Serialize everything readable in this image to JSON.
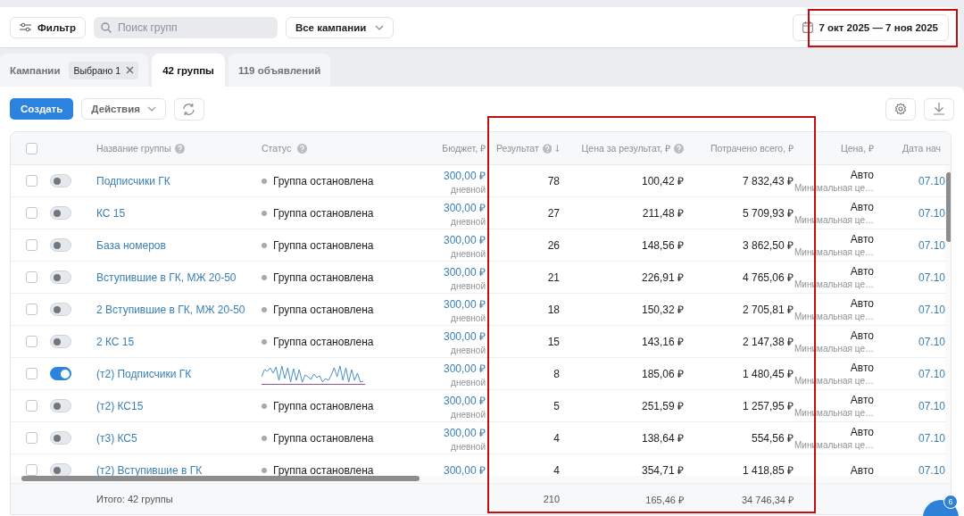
{
  "toolbar": {
    "filter_label": "Фильтр",
    "search": {
      "placeholder": "Поиск групп"
    },
    "campaign_select": "Все кампании",
    "date_range": "7 окт 2025 — 7 ноя 2025"
  },
  "tabs": [
    {
      "label": "Кампании",
      "chip": "Выбрано 1",
      "selected": false
    },
    {
      "label": "42 группы",
      "selected": true
    },
    {
      "label": "119 объявлений",
      "selected": false
    }
  ],
  "actions": {
    "create": "Создать",
    "actions_menu": "Действия"
  },
  "table": {
    "select_all": {
      "checked": false
    },
    "columns": [
      {
        "label": "Название группы",
        "help": true
      },
      {
        "label": "Статус",
        "help": true
      },
      {
        "label": "Бюджет, ₽",
        "help": false
      },
      {
        "label": "Результат",
        "help": true,
        "sorted": true
      },
      {
        "label": "Цена за результат, ₽",
        "help": true
      },
      {
        "label": "Потрачено всего, ₽",
        "help": false
      },
      {
        "label": "Цена, ₽",
        "help": false
      },
      {
        "label": "Дата нач",
        "help": false
      }
    ],
    "rows": [
      {
        "checked": false,
        "on": false,
        "name": "Подписчики ГК",
        "status": {
          "kind": "stopped",
          "text": "Группа остановлена"
        },
        "budget": "300,00 ₽",
        "budget_note": "дневной",
        "result": "78",
        "cost_per_result": "100,42 ₽",
        "spent": "7 832,43 ₽",
        "price": "Авто",
        "price_note": "Минимальная це…",
        "date": "07.10"
      },
      {
        "checked": false,
        "on": false,
        "name": "КС 15",
        "status": {
          "kind": "stopped",
          "text": "Группа остановлена"
        },
        "budget": "300,00 ₽",
        "budget_note": "дневной",
        "result": "27",
        "cost_per_result": "211,48 ₽",
        "spent": "5 709,93 ₽",
        "price": "Авто",
        "price_note": "Минимальная це…",
        "date": "07.10"
      },
      {
        "checked": false,
        "on": false,
        "name": "База номеров",
        "status": {
          "kind": "stopped",
          "text": "Группа остановлена"
        },
        "budget": "300,00 ₽",
        "budget_note": "дневной",
        "result": "26",
        "cost_per_result": "148,56 ₽",
        "spent": "3 862,50 ₽",
        "price": "Авто",
        "price_note": "Минимальная це…",
        "date": "07.10"
      },
      {
        "checked": false,
        "on": false,
        "name": "Вступившие в ГК, МЖ 20-50",
        "status": {
          "kind": "stopped",
          "text": "Группа остановлена"
        },
        "budget": "300,00 ₽",
        "budget_note": "дневной",
        "result": "21",
        "cost_per_result": "226,91 ₽",
        "spent": "4 765,06 ₽",
        "price": "Авто",
        "price_note": "Минимальная це…",
        "date": "07.10"
      },
      {
        "checked": false,
        "on": false,
        "name": "2 Вступившие в ГК, МЖ 20-50",
        "status": {
          "kind": "stopped",
          "text": "Группа остановлена"
        },
        "budget": "300,00 ₽",
        "budget_note": "дневной",
        "result": "18",
        "cost_per_result": "150,32 ₽",
        "spent": "2 705,81 ₽",
        "price": "Авто",
        "price_note": "Минимальная це…",
        "date": "07.10"
      },
      {
        "checked": false,
        "on": false,
        "name": "2 КС 15",
        "status": {
          "kind": "stopped",
          "text": "Группа остановлена"
        },
        "budget": "300,00 ₽",
        "budget_note": "дневной",
        "result": "15",
        "cost_per_result": "143,16 ₽",
        "spent": "2 147,38 ₽",
        "price": "Авто",
        "price_note": "Минимальная це…",
        "date": "07.10"
      },
      {
        "checked": false,
        "on": true,
        "name": "(т2) Подписчики ГК",
        "status": {
          "kind": "sparkline"
        },
        "budget": "300,00 ₽",
        "budget_note": "дневной",
        "result": "8",
        "cost_per_result": "185,06 ₽",
        "spent": "1 480,45 ₽",
        "price": "Авто",
        "price_note": "Минимальная це…",
        "date": "07.10"
      },
      {
        "checked": false,
        "on": false,
        "name": "(т2) КС15",
        "status": {
          "kind": "stopped",
          "text": "Группа остановлена"
        },
        "budget": "300,00 ₽",
        "budget_note": "дневной",
        "result": "5",
        "cost_per_result": "251,59 ₽",
        "spent": "1 257,95 ₽",
        "price": "Авто",
        "price_note": "Минимальная це…",
        "date": "07.10"
      },
      {
        "checked": false,
        "on": false,
        "name": "(т3) КС5",
        "status": {
          "kind": "stopped",
          "text": "Группа остановлена"
        },
        "budget": "300,00 ₽",
        "budget_note": "дневной",
        "result": "4",
        "cost_per_result": "138,64 ₽",
        "spent": "554,56 ₽",
        "price": "Авто",
        "price_note": "Минимальная це…",
        "date": "07.10"
      },
      {
        "checked": false,
        "on": false,
        "name": "(т2) Вступившие в ГК",
        "status": {
          "kind": "stopped",
          "text": "Группа остановлена"
        },
        "budget": "300,00 ₽",
        "result": "4",
        "cost_per_result": "354,71 ₽",
        "spent": "1 418,85 ₽",
        "price": "Авто",
        "date": "07.10"
      }
    ],
    "totals": {
      "label": "Итого: 42 группы",
      "result": "210",
      "cost_per_result": "165,46 ₽",
      "spent": "34 746,34 ₽"
    }
  },
  "chat": {
    "badge": "6"
  }
}
